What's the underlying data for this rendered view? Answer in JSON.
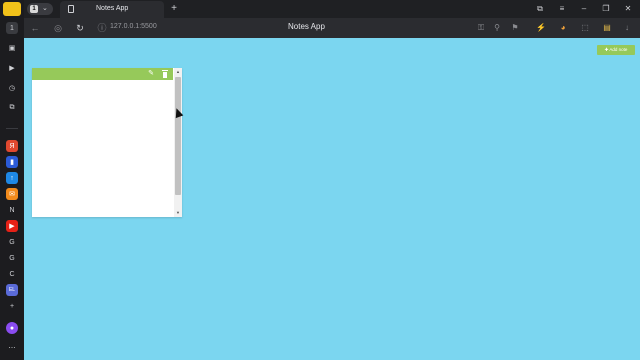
{
  "browser": {
    "tab_count": "1",
    "tab_title": "Notes App",
    "page_title": "Notes App",
    "url": "127.0.0.1:5500"
  },
  "sidebar": {
    "items": [
      {
        "name": "tab-counter-icon",
        "glyph": "1"
      },
      {
        "name": "collections-icon",
        "glyph": "▣"
      },
      {
        "name": "play-icon",
        "glyph": "▶"
      },
      {
        "name": "history-icon",
        "glyph": "◷"
      },
      {
        "name": "screenshot-icon",
        "glyph": "⧉"
      },
      {
        "name": "yandex-icon",
        "glyph": "Я"
      },
      {
        "name": "twitch-icon",
        "glyph": "▮"
      },
      {
        "name": "upload-icon",
        "glyph": "↑"
      },
      {
        "name": "mail-icon",
        "glyph": "✉"
      },
      {
        "name": "notion-icon",
        "glyph": "N"
      },
      {
        "name": "youtube-icon",
        "glyph": "▶"
      },
      {
        "name": "google-icon-1",
        "glyph": "G"
      },
      {
        "name": "google-icon-2",
        "glyph": "G"
      },
      {
        "name": "c-icon",
        "glyph": "C"
      },
      {
        "name": "el-icon",
        "glyph": "EL"
      },
      {
        "name": "add-panel-icon",
        "glyph": "+"
      },
      {
        "name": "alice-icon",
        "glyph": "●"
      },
      {
        "name": "more-icon",
        "glyph": "⋯"
      }
    ]
  },
  "app": {
    "add_note_label": "✚ Add note",
    "note": {
      "text": ""
    }
  },
  "colors": {
    "page_background": "#7bd6f0",
    "accent_green": "#96c95a",
    "browser_dark": "#1f2023"
  }
}
